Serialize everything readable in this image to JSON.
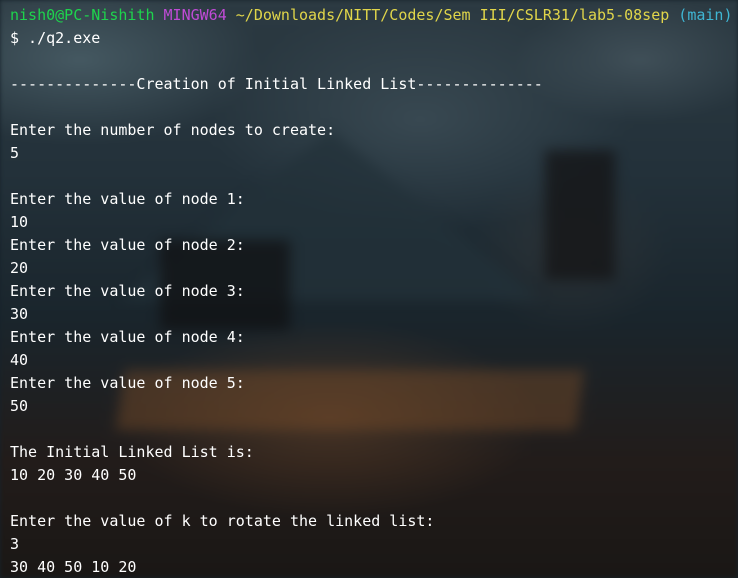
{
  "prompt": {
    "user_host": "nish0@PC-Nishith",
    "system": "MINGW64",
    "path": "~/Downloads/NITT/Codes/Sem III/CSLR31/lab5-08sep",
    "branch": "(main)"
  },
  "command": "$ ./q2.exe",
  "output_lines": [
    "",
    "--------------Creation of Initial Linked List--------------",
    "",
    "Enter the number of nodes to create:",
    "5",
    "",
    "Enter the value of node 1:",
    "10",
    "Enter the value of node 2:",
    "20",
    "Enter the value of node 3:",
    "30",
    "Enter the value of node 4:",
    "40",
    "Enter the value of node 5:",
    "50",
    "",
    "The Initial Linked List is:",
    "10 20 30 40 50",
    "",
    "Enter the value of k to rotate the linked list:",
    "3",
    "30 40 50 10 20"
  ],
  "colors": {
    "user_host": "#1ed44d",
    "system": "#c04bd6",
    "path": "#e0d54a",
    "branch": "#3fb6d4",
    "text": "#ffffff"
  }
}
